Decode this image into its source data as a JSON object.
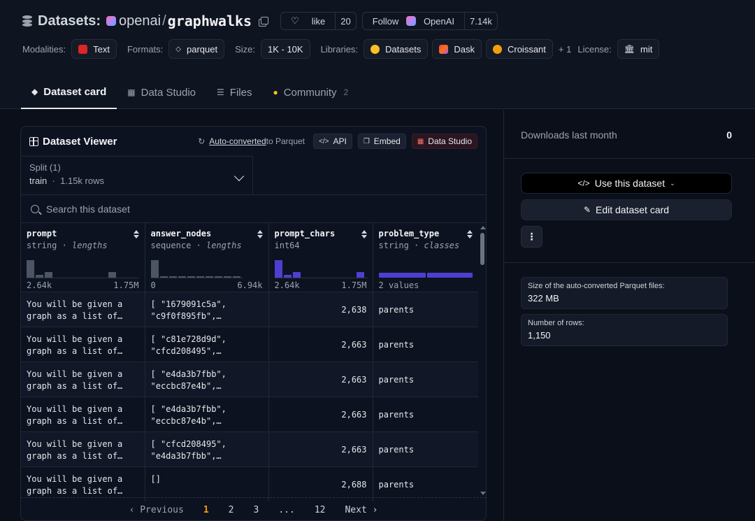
{
  "header": {
    "title_label": "Datasets:",
    "org": "openai",
    "slash": "/",
    "repo": "graphwalks",
    "like_label": "like",
    "like_count": "20",
    "follow_label": "Follow",
    "follow_org": "OpenAI",
    "follow_count": "7.14k"
  },
  "meta": {
    "modalities_label": "Modalities:",
    "modality": "Text",
    "formats_label": "Formats:",
    "format": "parquet",
    "size_label": "Size:",
    "size": "1K - 10K",
    "libraries_label": "Libraries:",
    "libraries": [
      "Datasets",
      "Dask",
      "Croissant"
    ],
    "libraries_more": "+ 1",
    "license_label": "License:",
    "license": "mit"
  },
  "tabs": [
    {
      "label": "Dataset card",
      "active": true
    },
    {
      "label": "Data Studio"
    },
    {
      "label": "Files"
    },
    {
      "label": "Community",
      "badge": "2"
    }
  ],
  "viewer": {
    "title": "Dataset Viewer",
    "auto_converted_link": "Auto-converted",
    "auto_converted_rest": " to Parquet",
    "api_label": "API",
    "embed_label": "Embed",
    "studio_label": "Data Studio",
    "split_label": "Split (1)",
    "split_name": "train",
    "split_sep": "·",
    "split_rows": "1.15k rows",
    "search_placeholder": "Search this dataset",
    "columns": [
      {
        "name": "prompt",
        "type": "string",
        "stat": "lengths",
        "min": "2.64k",
        "max": "1.75M",
        "hist": [
          0.9,
          0.15,
          0.3,
          0,
          0,
          0,
          0,
          0,
          0,
          0.3
        ]
      },
      {
        "name": "answer_nodes",
        "type": "sequence",
        "stat": "lengths",
        "min": "0",
        "max": "6.94k",
        "hist": [
          0.9,
          0.05,
          0.05,
          0.05,
          0.05,
          0.05,
          0.05,
          0.05,
          0.05,
          0.05
        ]
      },
      {
        "name": "prompt_chars",
        "type": "int64",
        "stat": "",
        "min": "2.64k",
        "max": "1.75M",
        "hist": [
          0.9,
          0.15,
          0.3,
          0,
          0,
          0,
          0,
          0,
          0,
          0.3
        ]
      },
      {
        "name": "problem_type",
        "type": "string",
        "stat": "classes",
        "min": "2 values",
        "max": "",
        "classes": [
          0.51,
          0.49
        ]
      }
    ],
    "rows": [
      {
        "prompt": "You will be given a graph as a list of…",
        "answer_nodes": "[ \"1679091c5a\", \"c9f0f895fb\",…",
        "prompt_chars": "2,638",
        "problem_type": "parents"
      },
      {
        "prompt": "You will be given a graph as a list of…",
        "answer_nodes": "[ \"c81e728d9d\", \"cfcd208495\",…",
        "prompt_chars": "2,663",
        "problem_type": "parents"
      },
      {
        "prompt": "You will be given a graph as a list of…",
        "answer_nodes": "[ \"e4da3b7fbb\", \"eccbc87e4b\",…",
        "prompt_chars": "2,663",
        "problem_type": "parents"
      },
      {
        "prompt": "You will be given a graph as a list of…",
        "answer_nodes": "[ \"e4da3b7fbb\", \"eccbc87e4b\",…",
        "prompt_chars": "2,663",
        "problem_type": "parents"
      },
      {
        "prompt": "You will be given a graph as a list of…",
        "answer_nodes": "[ \"cfcd208495\", \"e4da3b7fbb\",…",
        "prompt_chars": "2,663",
        "problem_type": "parents"
      },
      {
        "prompt": "You will be given a graph as a list of…",
        "answer_nodes": "[]",
        "prompt_chars": "2,688",
        "problem_type": "parents"
      }
    ],
    "pager": {
      "prev": "‹ Previous",
      "pages": [
        "1",
        "2",
        "3",
        "...",
        "12"
      ],
      "current": "1",
      "next": "Next ›"
    }
  },
  "sidebar": {
    "downloads_label": "Downloads last month",
    "downloads_value": "0",
    "use_label": "Use this dataset",
    "edit_label": "Edit dataset card",
    "more_label": "⋮",
    "size_label": "Size of the auto-converted Parquet files:",
    "size_value": "322 MB",
    "rows_label": "Number of rows:",
    "rows_value": "1,150"
  },
  "colors": {
    "accent_purple": "#4f3fd0",
    "pager_current": "#f59e0b",
    "studio_red": "#f87171"
  }
}
